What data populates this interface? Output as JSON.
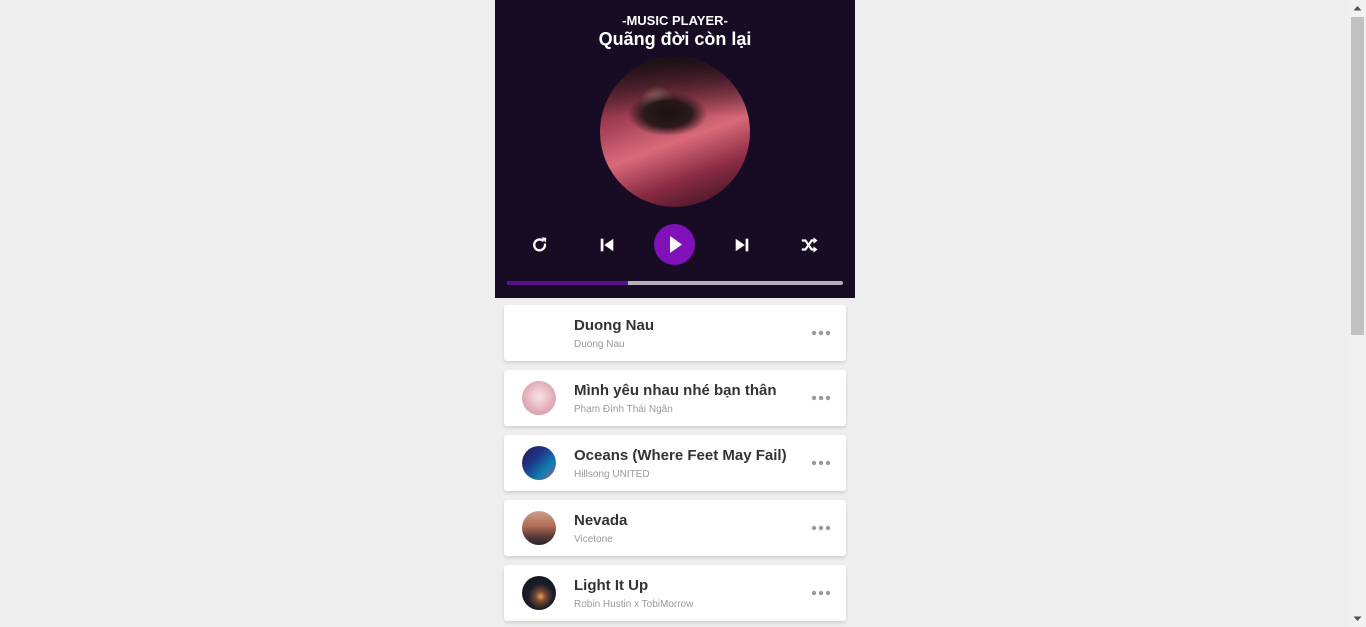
{
  "header": {
    "subtitle": "-MUSIC PLAYER-",
    "current_title": "Quãng đời còn lại"
  },
  "controls": {
    "repeat": "repeat-icon",
    "prev": "step-backward-icon",
    "play": "play-icon",
    "next": "step-forward-icon",
    "shuffle": "random-icon"
  },
  "progress": {
    "fraction": 0.36
  },
  "playlist": [
    {
      "title": "Duong Nau",
      "author": "Duong Nau",
      "thumb": "none"
    },
    {
      "title": "Mình yêu nhau nhé bạn thân",
      "author": "Phạm Đình Thái Ngân",
      "thumb": "pink"
    },
    {
      "title": "Oceans (Where Feet May Fail)",
      "author": "Hillsong UNITED",
      "thumb": "ocean"
    },
    {
      "title": "Nevada",
      "author": "Vicetone",
      "thumb": "sunset"
    },
    {
      "title": "Light It Up",
      "author": "Robin Hustin x TobiMorrow",
      "thumb": "dark"
    }
  ],
  "colors": {
    "player_bg": "#180c24",
    "accent": "#8011b8",
    "progress_fill": "#5a0e87",
    "page_bg": "#eeeeee"
  }
}
